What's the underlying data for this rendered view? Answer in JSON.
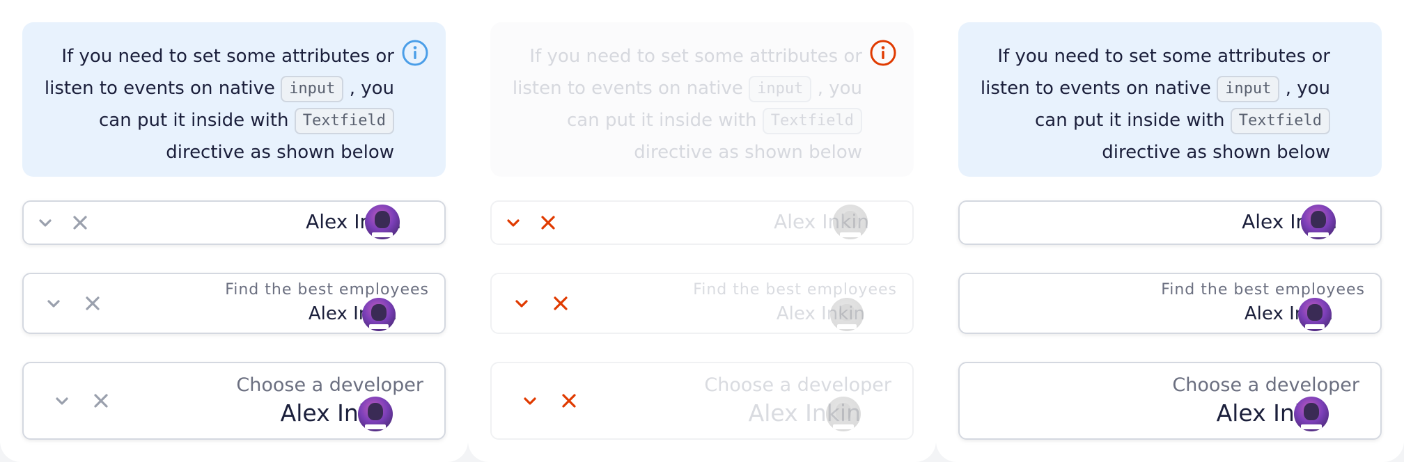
{
  "notice": {
    "line1": "If you need to set some attributes or",
    "line2a": "listen to events on native",
    "code1": "input",
    "line2b": ", you",
    "line3a": "can put it inside with",
    "code2": "Textfield",
    "line4": "directive as shown below",
    "icon": "info-circle-icon"
  },
  "fields": {
    "f1": {
      "value": "Alex Inkin"
    },
    "f2": {
      "label": "Find the best employees",
      "value": "Alex Inkin"
    },
    "f3": {
      "label": "Choose a developer",
      "value": "Alex Inkin"
    }
  },
  "colors": {
    "info": "#4a9ee8",
    "error": "#e03a00",
    "icon_gray": "#9aa0ad",
    "notice_bg": "#e8f2fd"
  }
}
